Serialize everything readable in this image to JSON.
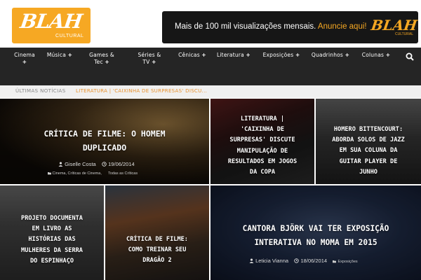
{
  "header": {
    "logo_word": "BLAH",
    "logo_sub": "CULTURAL",
    "ad": {
      "text": "Mais de 100 mil visualizações mensais.",
      "cta": "Anuncie aqui!",
      "logo_word": "BLAH",
      "logo_sub": "CULTURAL"
    }
  },
  "nav": {
    "items": [
      {
        "line1": "Cinema",
        "line2": ""
      },
      {
        "line1": "Música",
        "line2": ""
      },
      {
        "line1": "Games &",
        "line2": "Tec"
      },
      {
        "line1": "Séries &",
        "line2": "TV"
      },
      {
        "line1": "Cênicas",
        "line2": ""
      },
      {
        "line1": "Literatura",
        "line2": ""
      },
      {
        "line1": "Exposições",
        "line2": ""
      },
      {
        "line1": "Quadrinhos",
        "line2": ""
      },
      {
        "line1": "Colunas",
        "line2": ""
      }
    ],
    "plus": "+",
    "search_icon": "search-icon"
  },
  "ticker": {
    "label": "ÚLTIMAS NOTÍCIAS",
    "text": "LITERATURA | 'CAIXINHA DE SURPRESAS' DISCU..."
  },
  "tiles": [
    {
      "title_l1": "CRÍTICA DE FILME: O HOMEM",
      "title_l2": "DUPLICADO",
      "author": "Giselle Costa",
      "date": "19/06/2014",
      "cat1": "Cinema",
      "cat2": "Críticas de Cinema",
      "cat3": "Todas as Críticas",
      "sep": ","
    },
    {
      "lines": [
        "LITERATURA |",
        "'CAIXINHA DE",
        "SURPRESAS' DISCUTE",
        "MANIPULAÇÃO DE",
        "RESULTADOS EM JOGOS",
        "DA COPA"
      ]
    },
    {
      "lines": [
        "HOMERO BITTENCOURT:",
        "ABORDA SOLOS DE JAZZ",
        "EM SUA COLUNA DA",
        "GUITAR PLAYER DE",
        "JUNHO"
      ]
    },
    {
      "lines": [
        "PROJETO DOCUMENTA",
        "EM LIVRO AS",
        "HISTÓRIAS DAS",
        "MULHERES DA SERRA",
        "DO ESPINHAÇO"
      ]
    },
    {
      "lines": [
        "CRÍTICA DE FILME:",
        "COMO TREINAR SEU",
        "DRAGÃO 2"
      ]
    },
    {
      "title_l1": "CANTORA BJÖRK VAI TER EXPOSIÇÃO",
      "title_l2": "INTERATIVA NO MOMA EM 2015",
      "author": "Leticia Vianna",
      "date": "18/06/2014",
      "cat1": "Exposições"
    }
  ],
  "colors": {
    "brand_orange": "#f6a823",
    "nav_bg": "#252525",
    "ticker_accent": "#e8912d"
  }
}
